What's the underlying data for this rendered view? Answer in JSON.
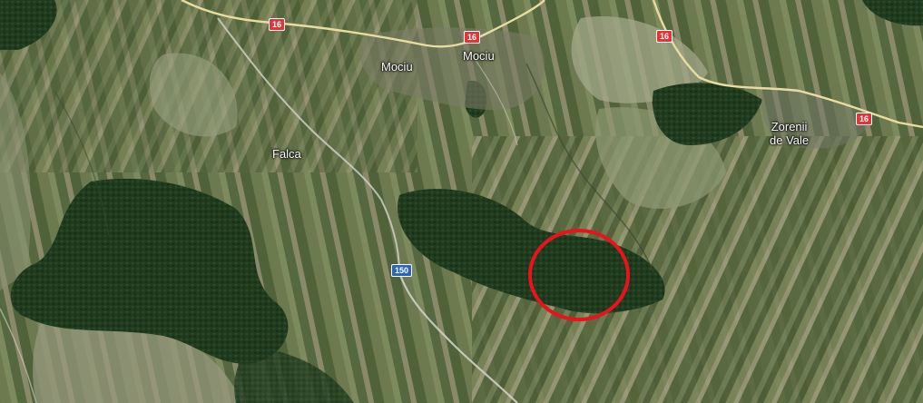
{
  "map": {
    "places": [
      {
        "id": "mociu-west",
        "label": "Mociu"
      },
      {
        "id": "mociu-town",
        "label": "Mociu"
      },
      {
        "id": "falca",
        "label": "Falca"
      },
      {
        "id": "zorenii-de-vale",
        "label": "Zorenii\nde Vale"
      }
    ],
    "road_shields": [
      {
        "id": "dn16-a",
        "label": "16",
        "color": "#e0363b"
      },
      {
        "id": "dn16-b",
        "label": "16",
        "color": "#e0363b"
      },
      {
        "id": "dn16-c",
        "label": "16",
        "color": "#e0363b"
      },
      {
        "id": "dn16-d",
        "label": "16",
        "color": "#e0363b"
      },
      {
        "id": "road-150",
        "label": "150",
        "color": "#2c64b8"
      }
    ],
    "highlight": {
      "shape": "circle",
      "color": "#e8141c"
    }
  }
}
